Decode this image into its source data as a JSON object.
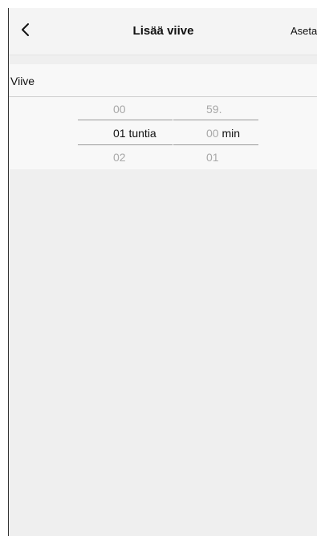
{
  "header": {
    "title": "Lisää viive",
    "action_label": "Aseta"
  },
  "section": {
    "label": "Viive"
  },
  "picker": {
    "hours": {
      "prev": "00",
      "selected": "01",
      "unit": "tuntia",
      "next": "02"
    },
    "minutes": {
      "prev": "59.",
      "selected": "00",
      "unit": "min",
      "next": "01"
    }
  }
}
